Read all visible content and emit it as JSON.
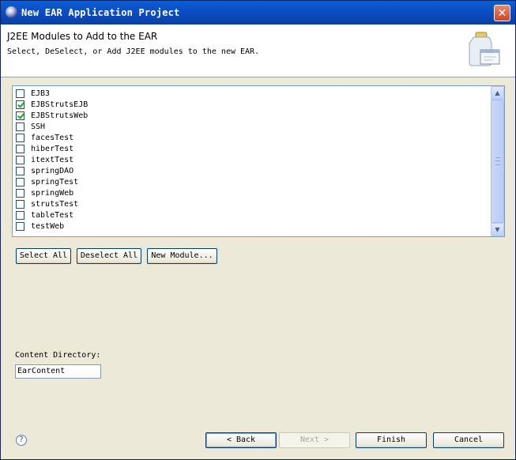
{
  "window": {
    "title": "New EAR Application Project",
    "close_glyph": "✕"
  },
  "banner": {
    "heading": "J2EE Modules to Add to the EAR",
    "description": "Select, DeSelect, or Add J2EE modules to the new EAR."
  },
  "modules": [
    {
      "name": "EJB3",
      "checked": false
    },
    {
      "name": "EJBStrutsEJB",
      "checked": true
    },
    {
      "name": "EJBStrutsWeb",
      "checked": true
    },
    {
      "name": "SSH",
      "checked": false
    },
    {
      "name": "facesTest",
      "checked": false
    },
    {
      "name": "hiberTest",
      "checked": false
    },
    {
      "name": "itextTest",
      "checked": false
    },
    {
      "name": "springDAO",
      "checked": false
    },
    {
      "name": "springTest",
      "checked": false
    },
    {
      "name": "springWeb",
      "checked": false
    },
    {
      "name": "strutsTest",
      "checked": false
    },
    {
      "name": "tableTest",
      "checked": false
    },
    {
      "name": "testWeb",
      "checked": false
    }
  ],
  "scrollbar": {
    "up_glyph": "▲",
    "down_glyph": "▼"
  },
  "list_buttons": {
    "select_all": "Select All",
    "deselect_all": "Deselect All",
    "new_module": "New Module..."
  },
  "content_directory": {
    "label": "Content Directory:",
    "value": "EarContent"
  },
  "footer": {
    "help_glyph": "?",
    "back": "< Back",
    "next": "Next >",
    "finish": "Finish",
    "cancel": "Cancel"
  },
  "icons": {
    "app": "eclipse-icon",
    "wizard": "jar-window-icon",
    "help": "help-icon"
  }
}
